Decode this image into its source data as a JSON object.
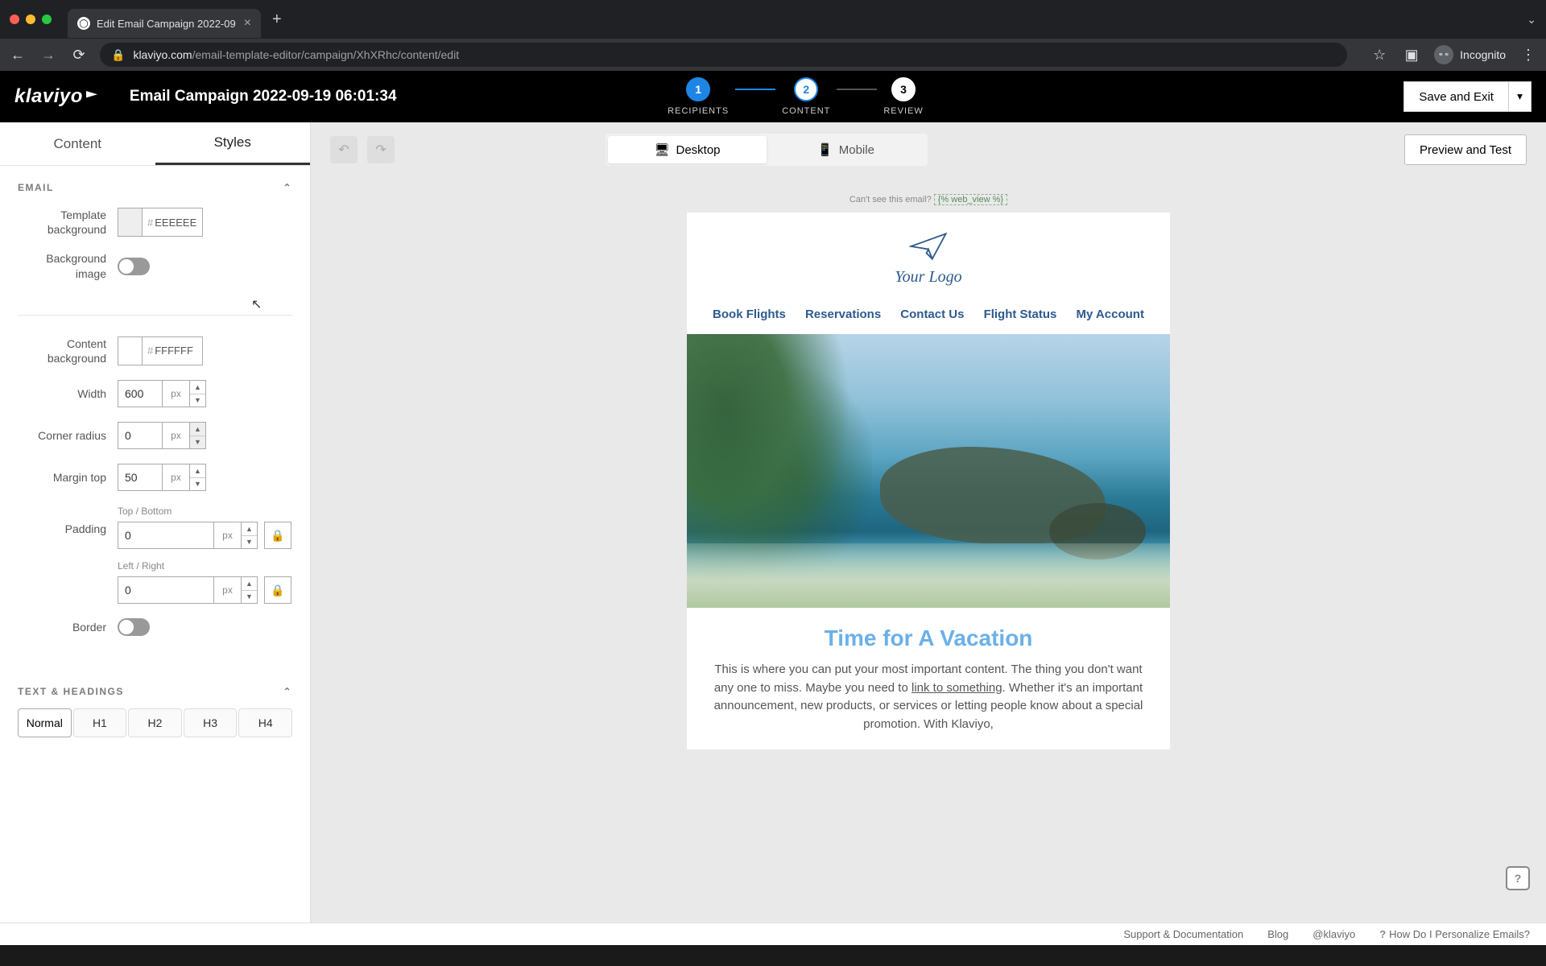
{
  "browser": {
    "tab_title": "Edit Email Campaign 2022-09",
    "url_host": "klaviyo.com",
    "url_path": "/email-template-editor/campaign/XhXRhc/content/edit",
    "incognito_label": "Incognito"
  },
  "app": {
    "logo": "klaviyo",
    "campaign_title": "Email Campaign 2022-09-19 06:01:34",
    "save_label": "Save and Exit"
  },
  "stepper": {
    "s1": {
      "num": "1",
      "label": "RECIPIENTS"
    },
    "s2": {
      "num": "2",
      "label": "CONTENT"
    },
    "s3": {
      "num": "3",
      "label": "REVIEW"
    }
  },
  "side_tabs": {
    "content": "Content",
    "styles": "Styles"
  },
  "toolbar": {
    "desktop": "Desktop",
    "mobile": "Mobile",
    "preview": "Preview and Test"
  },
  "styles": {
    "section_email": "EMAIL",
    "template_bg_label": "Template background",
    "template_bg_value": "EEEEEE",
    "bg_image_label": "Background image",
    "content_bg_label": "Content background",
    "content_bg_value": "FFFFFF",
    "width_label": "Width",
    "width_value": "600",
    "radius_label": "Corner radius",
    "radius_value": "0",
    "margin_label": "Margin top",
    "margin_value": "50",
    "padding_label": "Padding",
    "pad_tb_label": "Top / Bottom",
    "pad_tb_value": "0",
    "pad_lr_label": "Left / Right",
    "pad_lr_value": "0",
    "border_label": "Border",
    "px": "px",
    "section_text": "TEXT & HEADINGS",
    "htabs": {
      "normal": "Normal",
      "h1": "H1",
      "h2": "H2",
      "h3": "H3",
      "h4": "H4"
    }
  },
  "email": {
    "view_online_pre": "Can't see this email? ",
    "view_online_tag": "{% web_view %}",
    "logo_text": "Your Logo",
    "nav": {
      "a": "Book Flights",
      "b": "Reservations",
      "c": "Contact Us",
      "d": "Flight Status",
      "e": "My Account"
    },
    "headline": "Time for A Vacation",
    "body_pre": "This is where you can put your most important content. The thing you don't want any one to miss. Maybe you need to ",
    "body_link": "link to something",
    "body_post": ". Whether it's an important announcement, new products, or services or letting people know about a special promotion. With Klaviyo,"
  },
  "footer": {
    "support": "Support & Documentation",
    "blog": "Blog",
    "twitter": "@klaviyo",
    "help": "How Do I Personalize Emails?"
  }
}
